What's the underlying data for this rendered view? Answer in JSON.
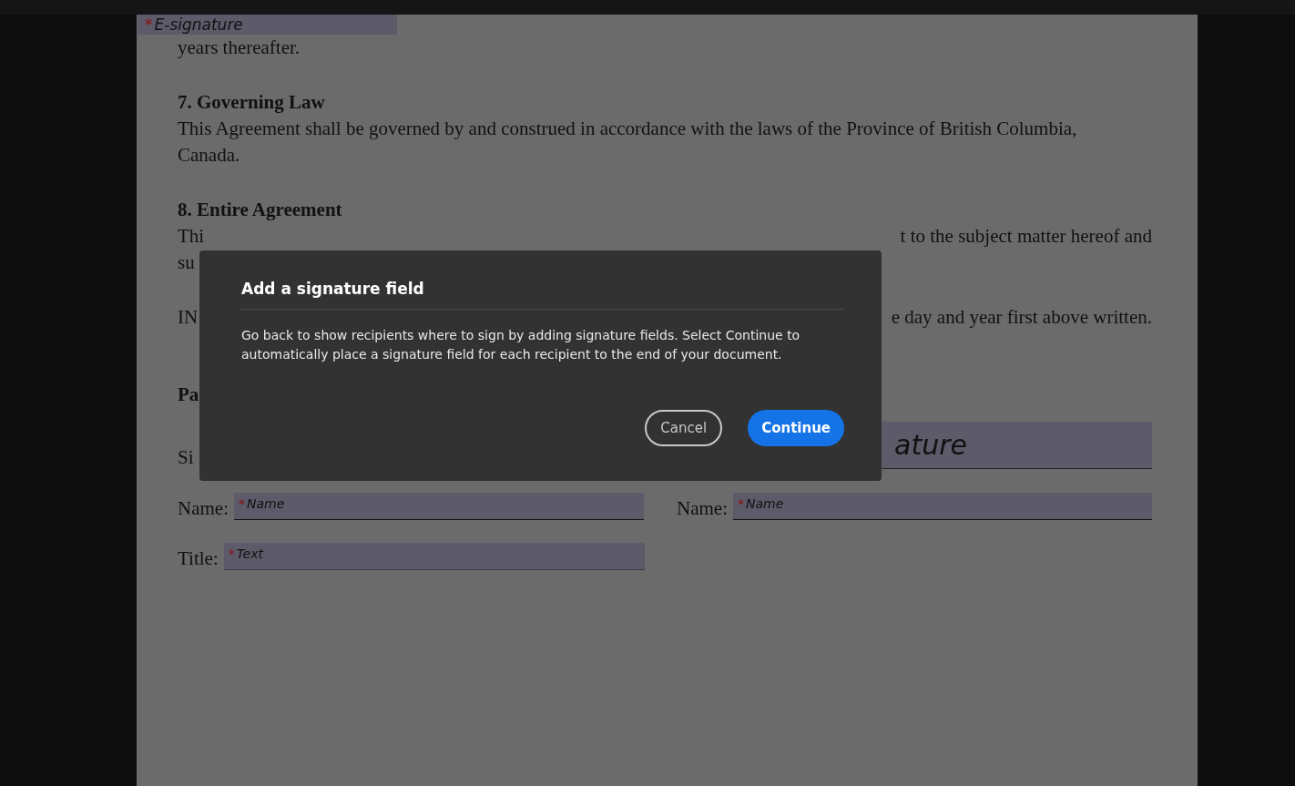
{
  "document": {
    "top_field": {
      "marker": "*",
      "placeholder": "E-signature"
    },
    "blocks": [
      {
        "kind": "paragraph",
        "lines": [
          {
            "left": "years thereafter."
          }
        ]
      },
      {
        "kind": "heading",
        "text": "7. Governing Law"
      },
      {
        "kind": "paragraph",
        "lines": [
          {
            "left": "This Agreement shall be governed by and construed in accordance with the laws of the Province of British Columbia,"
          },
          {
            "left": "Canada."
          }
        ]
      },
      {
        "kind": "heading",
        "text": "8. Entire Agreement"
      },
      {
        "kind": "paragraph",
        "lines": [
          {
            "left": "Thi",
            "right": "t to the subject matter hereof and"
          },
          {
            "left": "su"
          }
        ]
      },
      {
        "kind": "paragraph",
        "lines": [
          {
            "left": "IN",
            "right": "e day and year first above written."
          }
        ]
      }
    ],
    "parties_heading": "Pa",
    "signature_row": {
      "label": "Si",
      "field_text": "ature"
    },
    "name_fields": [
      {
        "label": "Name:",
        "marker": "*",
        "placeholder": "Name"
      },
      {
        "label": "Name:",
        "marker": "*",
        "placeholder": "Name"
      }
    ],
    "title_field": {
      "label": "Title:",
      "marker": "*",
      "placeholder": "Text"
    }
  },
  "dialog": {
    "title": "Add a signature field",
    "message": "Go back to show recipients where to sign by adding signature fields. Select Continue to automatically place a signature field for each recipient to the end of your document.",
    "buttons": [
      {
        "label": "Cancel",
        "kind": "secondary"
      },
      {
        "label": "Continue",
        "kind": "primary"
      }
    ]
  }
}
